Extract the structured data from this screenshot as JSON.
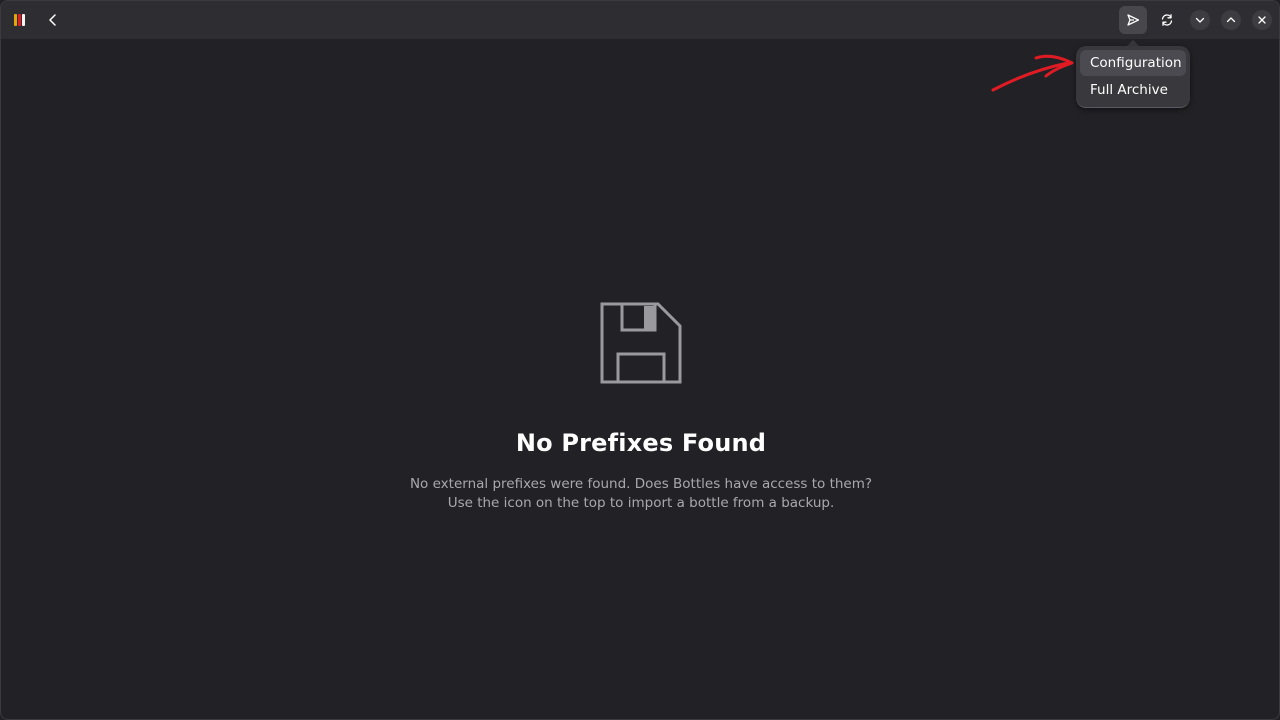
{
  "header": {
    "back_icon": "go-previous-icon",
    "import_icon": "send-icon",
    "refresh_icon": "view-refresh-icon",
    "minimize_icon": "chevron-down-icon",
    "maximize_icon": "chevron-up-icon",
    "close_icon": "close-icon"
  },
  "import_menu": {
    "items": [
      {
        "label": "Configuration"
      },
      {
        "label": "Full Archive"
      }
    ]
  },
  "status_page": {
    "icon": "floppy-disk-icon",
    "title": "No Prefixes Found",
    "description_line1": "No external prefixes were found. Does Bottles have access to them?",
    "description_line2": "Use the icon on the top to import a bottle from a backup."
  },
  "colors": {
    "background": "#222226",
    "headerbar": "#2e2e32",
    "popover": "#38383d",
    "annotation": "#e01b24",
    "muted_text": "#a9a9ad"
  }
}
